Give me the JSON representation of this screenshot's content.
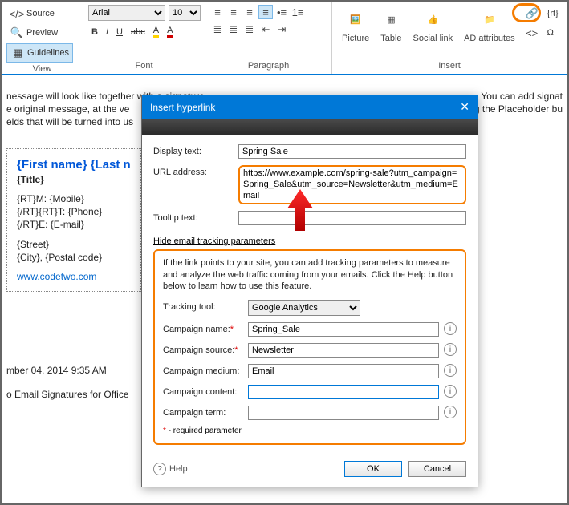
{
  "ribbon": {
    "view": {
      "source": "Source",
      "preview": "Preview",
      "guidelines": "Guidelines",
      "label": "View"
    },
    "font": {
      "family": "Arial",
      "size": "10",
      "label": "Font"
    },
    "paragraph": {
      "label": "Paragraph"
    },
    "insert": {
      "picture": "Picture",
      "table": "Table",
      "social": "Social link",
      "ad": "AD attributes",
      "rt": "{rt}",
      "omega": "Ω",
      "label": "Insert"
    }
  },
  "doc": {
    "line1": "nessage will look like together with a signature.",
    "line1b": "You can add signat",
    "line2": "e original message, at the ve",
    "line2b": "g the Placeholder bu",
    "line3": "elds that will be turned into us",
    "sig_name": "{First name} {Last n",
    "sig_title": "{Title}",
    "sig_r1": "{RT}M: {Mobile}",
    "sig_r2": "{/RT}{RT}T: {Phone}",
    "sig_r3": "{/RT}E: {E-mail}",
    "sig_street": "{Street}",
    "sig_city": "{City}, {Postal code}",
    "sig_link": "www.codetwo.com",
    "ts": "mber 04, 2014 9:35 AM",
    "footer": "o Email Signatures for Office"
  },
  "dialog": {
    "title": "Insert hyperlink",
    "display_label": "Display text:",
    "display_value": "Spring Sale",
    "url_label": "URL address:",
    "url_value": "https://www.example.com/spring-sale?utm_campaign=Spring_Sale&utm_source=Newsletter&utm_medium=Email",
    "tooltip_label": "Tooltip text:",
    "tooltip_value": "",
    "hide_label": "Hide email tracking parameters",
    "track_help": "If the link points to your site, you can add tracking parameters to measure and analyze the web traffic coming from your emails. Click the Help button below to learn how to use this feature.",
    "tool_label": "Tracking tool:",
    "tool_value": "Google Analytics",
    "cname_label": "Campaign name:",
    "cname_value": "Spring_Sale",
    "csrc_label": "Campaign source:",
    "csrc_value": "Newsletter",
    "cmed_label": "Campaign medium:",
    "cmed_value": "Email",
    "ccon_label": "Campaign content:",
    "ccon_value": "",
    "cterm_label": "Campaign term:",
    "cterm_value": "",
    "req_note": "* - required parameter",
    "help": "Help",
    "ok": "OK",
    "cancel": "Cancel"
  }
}
